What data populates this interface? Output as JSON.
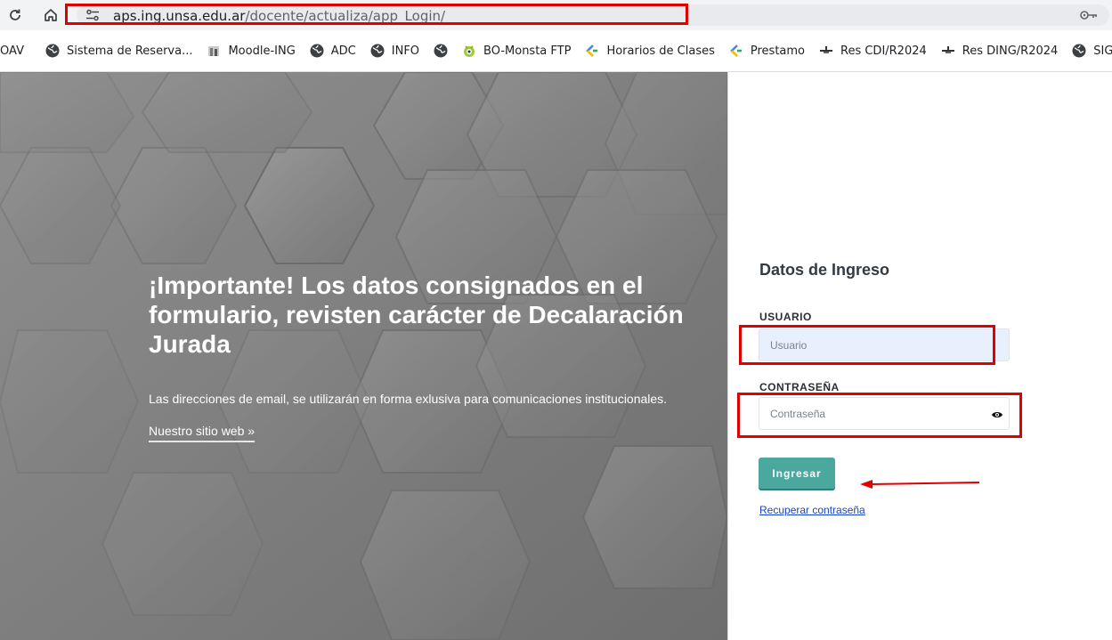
{
  "browser": {
    "url_domain": "aps.ing.unsa.edu.ar",
    "url_path": "/docente/actualiza/app_Login/",
    "reload_icon": "reload-icon",
    "home_icon": "home-icon",
    "site_info_icon": "tune-icon",
    "password_key_icon": "key-icon"
  },
  "bookmarks": [
    {
      "label": "OAV",
      "icon": "none"
    },
    {
      "label": "Sistema de Reserva...",
      "icon": "globe-icon"
    },
    {
      "label": "Moodle-ING",
      "icon": "moodle-icon"
    },
    {
      "label": "ADC",
      "icon": "globe-icon"
    },
    {
      "label": "INFO",
      "icon": "globe-icon"
    },
    {
      "label": "",
      "icon": "globe-icon"
    },
    {
      "label": "BO-Monsta FTP",
      "icon": "monsta-icon"
    },
    {
      "label": "Horarios de Clases",
      "icon": "apps-script-icon"
    },
    {
      "label": "Prestamo",
      "icon": "apps-script-icon"
    },
    {
      "label": "Res CDI/R2024",
      "icon": "pin-icon"
    },
    {
      "label": "Res DING/R2024",
      "icon": "pin-icon"
    },
    {
      "label": "SIGAE-A",
      "icon": "globe-icon"
    }
  ],
  "hero": {
    "title": "¡Importante! Los datos consignados en el formulario, revisten carácter de Decalaración Jurada",
    "text": "Las direcciones de email, se utilizarán en forma exlusiva para comunicaciones institucionales.",
    "link": "Nuestro sitio web »"
  },
  "login": {
    "title": "Datos de Ingreso",
    "user_label": "USUARIO",
    "user_placeholder": "Usuario",
    "password_label": "CONTRASEÑA",
    "password_placeholder": "Contraseña",
    "submit": "Ingresar",
    "recover": "Recuperar contraseña"
  },
  "colors": {
    "annotation": "#e00000",
    "button": "#4aa89e",
    "link": "#1a45c4"
  }
}
